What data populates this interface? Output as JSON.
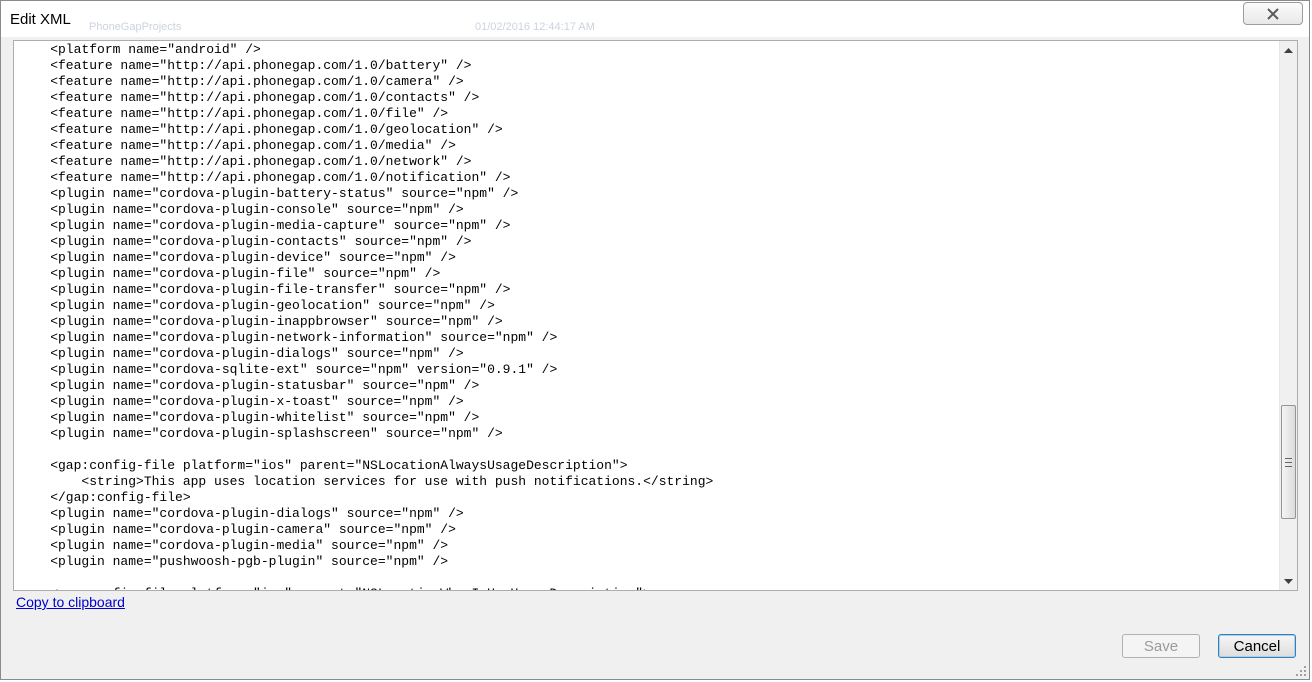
{
  "window": {
    "title": "Edit XML"
  },
  "editor": {
    "lines": [
      "<platform name=\"android\" />",
      "<feature name=\"http://api.phonegap.com/1.0/battery\" />",
      "<feature name=\"http://api.phonegap.com/1.0/camera\" />",
      "<feature name=\"http://api.phonegap.com/1.0/contacts\" />",
      "<feature name=\"http://api.phonegap.com/1.0/file\" />",
      "<feature name=\"http://api.phonegap.com/1.0/geolocation\" />",
      "<feature name=\"http://api.phonegap.com/1.0/media\" />",
      "<feature name=\"http://api.phonegap.com/1.0/network\" />",
      "<feature name=\"http://api.phonegap.com/1.0/notification\" />",
      "<plugin name=\"cordova-plugin-battery-status\" source=\"npm\" />",
      "<plugin name=\"cordova-plugin-console\" source=\"npm\" />",
      "<plugin name=\"cordova-plugin-media-capture\" source=\"npm\" />",
      "<plugin name=\"cordova-plugin-contacts\" source=\"npm\" />",
      "<plugin name=\"cordova-plugin-device\" source=\"npm\" />",
      "<plugin name=\"cordova-plugin-file\" source=\"npm\" />",
      "<plugin name=\"cordova-plugin-file-transfer\" source=\"npm\" />",
      "<plugin name=\"cordova-plugin-geolocation\" source=\"npm\" />",
      "<plugin name=\"cordova-plugin-inappbrowser\" source=\"npm\" />",
      "<plugin name=\"cordova-plugin-network-information\" source=\"npm\" />",
      "<plugin name=\"cordova-plugin-dialogs\" source=\"npm\" />",
      "<plugin name=\"cordova-sqlite-ext\" source=\"npm\" version=\"0.9.1\" />",
      "<plugin name=\"cordova-plugin-statusbar\" source=\"npm\" />",
      "<plugin name=\"cordova-plugin-x-toast\" source=\"npm\" />",
      "<plugin name=\"cordova-plugin-whitelist\" source=\"npm\" />",
      "<plugin name=\"cordova-plugin-splashscreen\" source=\"npm\" />",
      "",
      "<gap:config-file platform=\"ios\" parent=\"NSLocationAlwaysUsageDescription\">",
      "    <string>This app uses location services for use with push notifications.</string>",
      "</gap:config-file>",
      "<plugin name=\"cordova-plugin-dialogs\" source=\"npm\" />",
      "<plugin name=\"cordova-plugin-camera\" source=\"npm\" />",
      "<plugin name=\"cordova-plugin-media\" source=\"npm\" />",
      "<plugin name=\"pushwoosh-pgb-plugin\" source=\"npm\" />",
      "",
      "<gap:config-file platform=\"ios\" parent=\"NSLocationWhenInUseUsageDescription\">"
    ],
    "indent": "    "
  },
  "links": {
    "copy_to_clipboard": "Copy to clipboard"
  },
  "buttons": {
    "save": "Save",
    "cancel": "Cancel"
  },
  "background": {
    "item_1": "PhoneGapProjects",
    "date_1": "01/02/2016 12:44:17 AM"
  },
  "colors": {
    "link": "#0000cc",
    "dialog_bg": "#f0f0f0",
    "cancel_border": "#3c7fb1"
  }
}
